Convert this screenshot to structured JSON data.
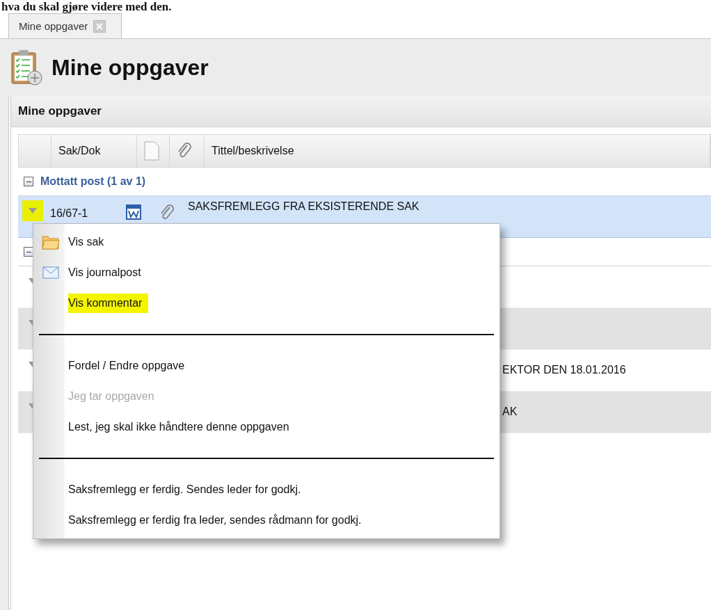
{
  "caption": "hva du skal gjøre videre med den.",
  "tabs": [
    {
      "label": "Mine oppgaver",
      "selected": true
    }
  ],
  "page_title": "Mine oppgaver",
  "panel": {
    "title": "Mine oppgaver",
    "columns": [
      "Sak/Dok",
      "Tittel/beskrivelse"
    ],
    "groups": [
      {
        "label": "Mottatt post (1 av 1)",
        "expanded": true,
        "rows": [
          {
            "kind": "full",
            "selected": true,
            "highlighted": true,
            "sak": "16/67-1",
            "title": "SAKSFREMLEGG FRA EKSISTERENDE SAK"
          }
        ]
      },
      {
        "expanded": true,
        "rows": [
          {
            "kind": "covered",
            "selected": false,
            "highlighted": false
          },
          {
            "kind": "covered",
            "selected": false,
            "highlighted": false
          },
          {
            "kind": "covered",
            "selected": false,
            "highlighted": false,
            "title": "EKTOR DEN 18.01.2016"
          },
          {
            "kind": "covered",
            "selected": false,
            "highlighted": false,
            "title": "AK"
          }
        ]
      }
    ]
  },
  "menu": {
    "sections": [
      [
        {
          "label": "Vis sak",
          "disabled": false,
          "highlighted": false
        },
        {
          "label": "Vis journalpost",
          "disabled": false,
          "highlighted": false
        },
        {
          "label": "Vis kommentar",
          "disabled": false,
          "highlighted": true
        }
      ],
      [
        {
          "label": "Fordel / Endre oppgave",
          "disabled": false,
          "highlighted": false
        },
        {
          "label": "Jeg tar oppgaven",
          "disabled": true,
          "highlighted": false
        },
        {
          "label": "Lest, jeg skal ikke håndtere denne oppgaven",
          "disabled": false,
          "highlighted": false
        }
      ],
      [
        {
          "label": "Saksfremlegg er ferdig. Sendes leder for godkj.",
          "disabled": false,
          "highlighted": false
        },
        {
          "label": "Saksfremlegg er ferdig fra leder, sendes rådmann for godkj.",
          "disabled": false,
          "highlighted": false
        }
      ]
    ]
  }
}
